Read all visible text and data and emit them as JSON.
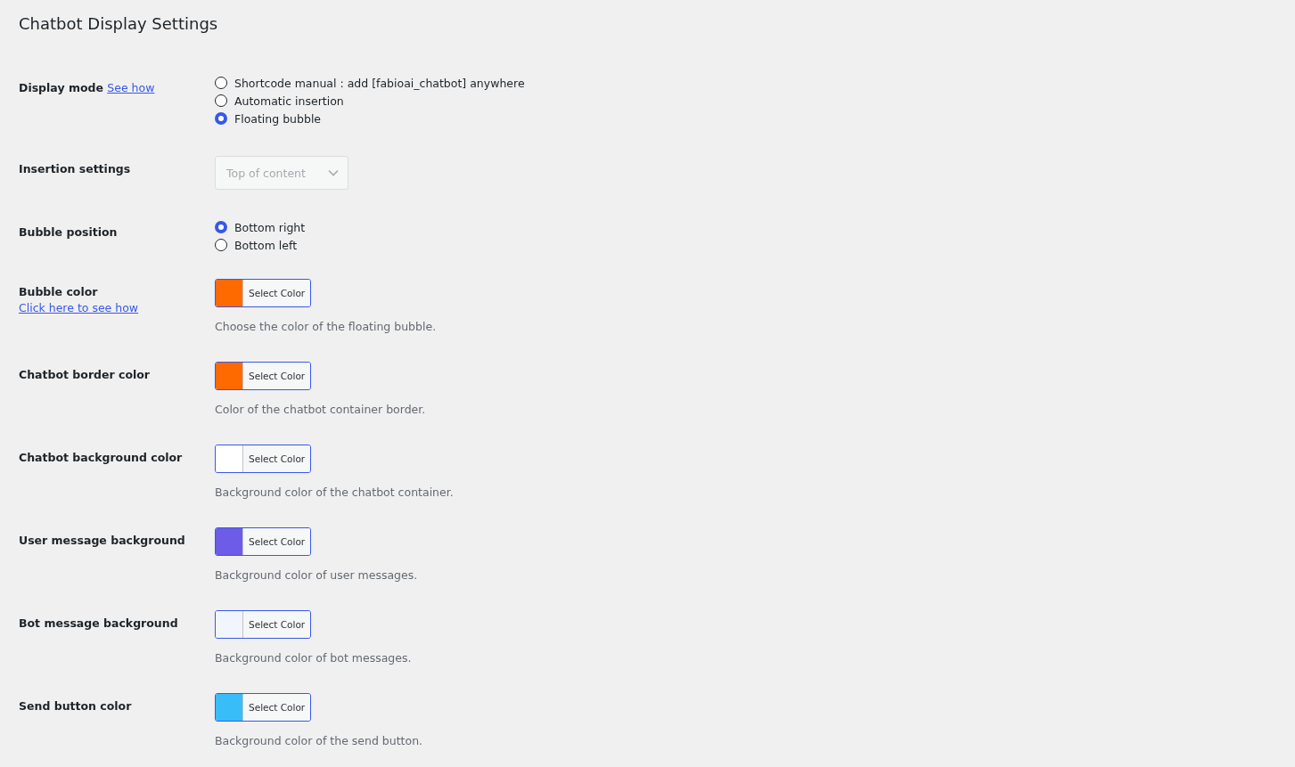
{
  "title": "Chatbot Display Settings",
  "rows": [
    {
      "kind": "radio",
      "label": "Display mode",
      "link": "See how",
      "options": [
        {
          "label": "Shortcode manual : add [fabioai_chatbot] anywhere",
          "selected": false
        },
        {
          "label": "Automatic insertion",
          "selected": false
        },
        {
          "label": "Floating bubble",
          "selected": true
        }
      ]
    },
    {
      "kind": "select",
      "label": "Insertion settings",
      "value": "Top of content",
      "disabled": true
    },
    {
      "kind": "radio",
      "label": "Bubble position",
      "options": [
        {
          "label": "Bottom right",
          "selected": true
        },
        {
          "label": "Bottom left",
          "selected": false
        }
      ]
    },
    {
      "kind": "color",
      "label": "Bubble color",
      "link": "Click here to see how",
      "color": "#ff6a00",
      "button": "Select Color",
      "description": "Choose the color of the floating bubble."
    },
    {
      "kind": "color",
      "label": "Chatbot border color",
      "color": "#ff6a00",
      "button": "Select Color",
      "description": "Color of the chatbot container border."
    },
    {
      "kind": "color",
      "label": "Chatbot background color",
      "color": "#ffffff",
      "button": "Select Color",
      "description": "Background color of the chatbot container."
    },
    {
      "kind": "color",
      "label": "User message background",
      "color": "#6c5ce7",
      "button": "Select Color",
      "description": "Background color of user messages."
    },
    {
      "kind": "color",
      "label": "Bot message background",
      "color": "#f1f5fe",
      "button": "Select Color",
      "description": "Background color of bot messages."
    },
    {
      "kind": "color",
      "label": "Send button color",
      "color": "#38bdf8",
      "button": "Select Color",
      "description": "Background color of the send button."
    }
  ]
}
